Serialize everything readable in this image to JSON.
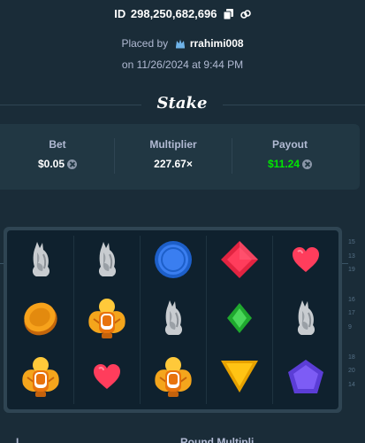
{
  "bet_id": {
    "label": "ID",
    "value": "298,250,682,696"
  },
  "placed_by": {
    "text": "Placed by",
    "user": "rrahimi008"
  },
  "placed_on": "on 11/26/2024 at 9:44 PM",
  "brand": "Stake",
  "stats": {
    "bet_label": "Bet",
    "bet_value": "$0.05",
    "multiplier_label": "Multiplier",
    "multiplier_value": "227.67×",
    "payout_label": "Payout",
    "payout_value": "$11.24"
  },
  "colors": {
    "payout": "#00e701",
    "background": "#1a2c38",
    "panel": "#213743",
    "board": "#0f212e"
  },
  "board": {
    "rows": [
      [
        "wolf-icon",
        "wolf-icon",
        "blue-coin-icon",
        "red-diamond-icon",
        "red-heart-icon"
      ],
      [
        "gold-coin-icon",
        "scarab-icon",
        "wolf-icon",
        "green-gem-icon",
        "wolf-icon"
      ],
      [
        "scarab-icon",
        "red-heart-icon",
        "scarab-icon",
        "yellow-triangle-icon",
        "purple-pentagon-icon"
      ]
    ]
  },
  "side_numbers": [
    {
      "value": "15"
    },
    {
      "value": "13"
    },
    {
      "value": "19"
    },
    {
      "value": "16"
    },
    {
      "value": "17"
    },
    {
      "value": "9"
    },
    {
      "value": "18"
    },
    {
      "value": "20"
    },
    {
      "value": "14"
    }
  ],
  "footer": {
    "left": "L",
    "right": "Round Multipli"
  }
}
